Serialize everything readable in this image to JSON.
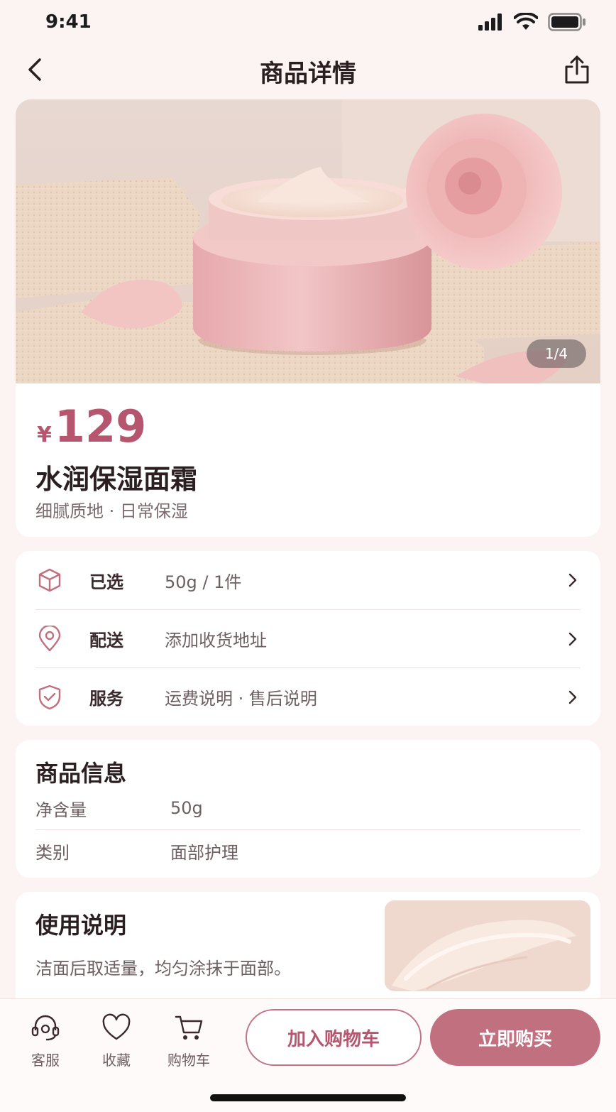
{
  "status_bar": {
    "time": "9:41",
    "icons": [
      "signal-icon",
      "wifi-icon",
      "battery-icon"
    ]
  },
  "nav": {
    "title": "商品详情",
    "back_icon": "chevron-left-icon",
    "share_icon": "share-icon"
  },
  "hero": {
    "counter": "1/4"
  },
  "product": {
    "price_symbol": "¥",
    "price": "129",
    "name": "水润保湿面霜",
    "subtitle": "细腻质地 · 日常保湿"
  },
  "options": [
    {
      "icon": "box-icon",
      "label": "已选",
      "value": "50g / 1件"
    },
    {
      "icon": "location-pin-icon",
      "label": "配送",
      "value": "添加收货地址"
    },
    {
      "icon": "shield-check-icon",
      "label": "服务",
      "value": "运费说明 · 售后说明"
    }
  ],
  "info": {
    "title": "商品信息",
    "rows": [
      {
        "label": "净含量",
        "value": "50g"
      },
      {
        "label": "类别",
        "value": "面部护理"
      }
    ]
  },
  "usage": {
    "title": "使用说明",
    "text": "洁面后取适量，均匀涂抹于面部。"
  },
  "bottom_bar": {
    "items": [
      {
        "icon": "headset-icon",
        "label": "客服"
      },
      {
        "icon": "heart-icon",
        "label": "收藏"
      },
      {
        "icon": "cart-icon",
        "label": "购物车"
      }
    ],
    "add_to_cart": "加入购物车",
    "buy_now": "立即购买"
  },
  "colors": {
    "accent": "#b5556e",
    "button": "#c0707f",
    "background": "#fbf4f3"
  }
}
